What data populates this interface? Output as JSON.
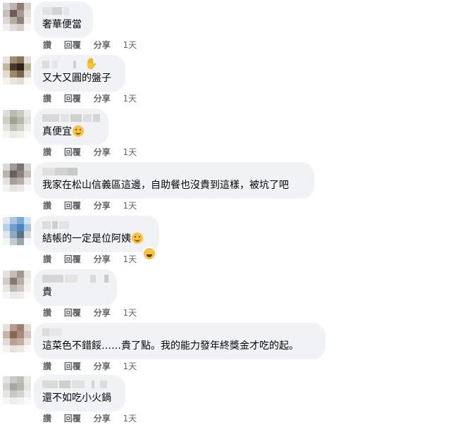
{
  "actions": {
    "like": "讚",
    "reply": "回覆",
    "share": "分享"
  },
  "comments": [
    {
      "text": "奢華便當",
      "time": "1天"
    },
    {
      "text": "又大又圓的盤子",
      "time": "1天"
    },
    {
      "text": "真便宜",
      "time": "1天"
    },
    {
      "text": "我家在松山信義區這邊，自助餐也沒貴到這樣，被坑了吧",
      "time": "1天"
    },
    {
      "text": "結帳的一定是位阿姨",
      "time": "1天"
    },
    {
      "text": "貴",
      "time": "1天"
    },
    {
      "text": "這菜色不錯餒……貴了點。我的能力發年終獎金才吃的起。",
      "time": "1天"
    },
    {
      "text": "還不如吃小火鍋",
      "time": "1天"
    }
  ],
  "icons": {
    "waving_hand": "waving-hand-icon",
    "smile_emoji": "smile-emoji-icon",
    "laugh_reaction": "laugh-reaction-icon"
  },
  "colors": {
    "bubble": "#f0f2f5",
    "meta_text": "#65676b",
    "text": "#050505",
    "emoji": "#f7c23c"
  }
}
